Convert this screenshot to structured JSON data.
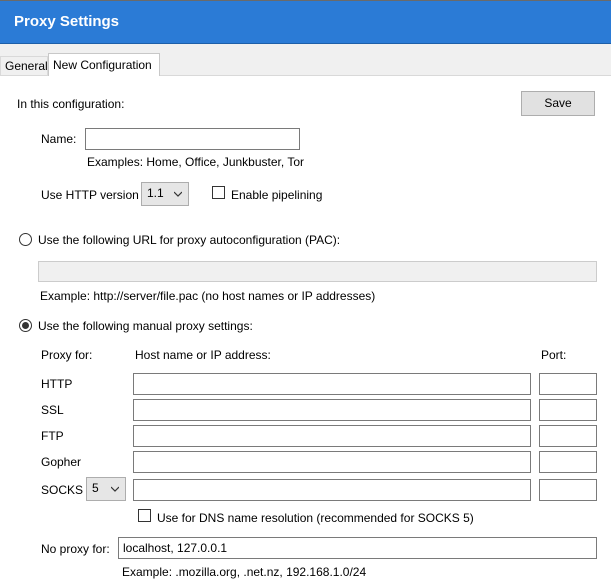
{
  "window": {
    "title": "Proxy Settings"
  },
  "tabs": [
    {
      "label": "General",
      "active": false
    },
    {
      "label": "New Configuration",
      "active": true
    }
  ],
  "config": {
    "intro_label": "In this configuration:",
    "save_label": "Save",
    "name_label": "Name:",
    "name_value": "",
    "name_examples": "Examples: Home, Office, Junkbuster, Tor",
    "http_version_label": "Use HTTP version",
    "http_version_value": "1.1",
    "pipelining_label": "Enable pipelining",
    "pipelining_checked": false
  },
  "pac": {
    "radio_label": "Use the following URL for proxy autoconfiguration (PAC):",
    "selected": false,
    "url_value": "",
    "example": "Example: http://server/file.pac (no host names or IP addresses)"
  },
  "manual": {
    "radio_label": "Use the following manual proxy settings:",
    "selected": true,
    "col_proxy_for": "Proxy for:",
    "col_host": "Host name or IP address:",
    "col_port": "Port:",
    "rows": [
      {
        "label": "HTTP",
        "host": "",
        "port": ""
      },
      {
        "label": "SSL",
        "host": "",
        "port": ""
      },
      {
        "label": "FTP",
        "host": "",
        "port": ""
      },
      {
        "label": "Gopher",
        "host": "",
        "port": ""
      }
    ],
    "socks": {
      "label": "SOCKS",
      "version": "5",
      "host": "",
      "port": ""
    },
    "dns_label": "Use for DNS name resolution (recommended for SOCKS 5)",
    "dns_checked": false,
    "no_proxy_label": "No proxy for:",
    "no_proxy_value": "localhost, 127.0.0.1",
    "no_proxy_example": "Example: .mozilla.org, .net.nz, 192.168.1.0/24"
  },
  "colors": {
    "titlebar": "#2b7bd6",
    "button_face": "#e1e1e1",
    "disabled_field": "#f0f0f0"
  }
}
